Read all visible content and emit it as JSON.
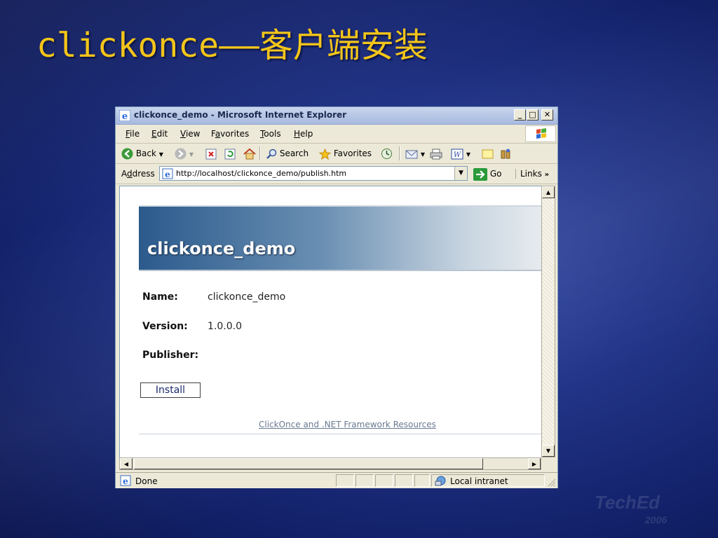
{
  "slide": {
    "title": "clickonce——客户端安装",
    "watermark": {
      "main": "TechEd",
      "year": "2006"
    }
  },
  "window": {
    "title": "clickonce_demo - Microsoft Internet Explorer",
    "controls": {
      "minimize": "_",
      "maximize": "□",
      "close": "✕"
    }
  },
  "menu": [
    {
      "key": "F",
      "rest": "ile"
    },
    {
      "key": "E",
      "rest": "dit"
    },
    {
      "key": "V",
      "rest": "iew"
    },
    {
      "pre": "F",
      "key": "a",
      "rest": "vorites"
    },
    {
      "key": "T",
      "rest": "ools"
    },
    {
      "key": "H",
      "rest": "elp"
    }
  ],
  "toolbar": {
    "back": "Back",
    "search": "Search",
    "favorites": "Favorites"
  },
  "address": {
    "label_pre": "A",
    "label_key": "d",
    "label_rest": "dress",
    "url": "http://localhost/clickonce_demo/publish.htm",
    "go": "Go",
    "links": "Links"
  },
  "page": {
    "banner_title": "clickonce_demo",
    "name_label": "Name:",
    "name_value": "clickonce_demo",
    "version_label": "Version:",
    "version_value": "1.0.0.0",
    "publisher_label": "Publisher:",
    "publisher_value": "",
    "install_button": "Install",
    "resources_link": "ClickOnce and .NET Framework Resources"
  },
  "status": {
    "text": "Done",
    "zone": "Local intranet"
  },
  "colors": {
    "title_accent": "#f3c51a",
    "background": "#1b2c7a"
  }
}
